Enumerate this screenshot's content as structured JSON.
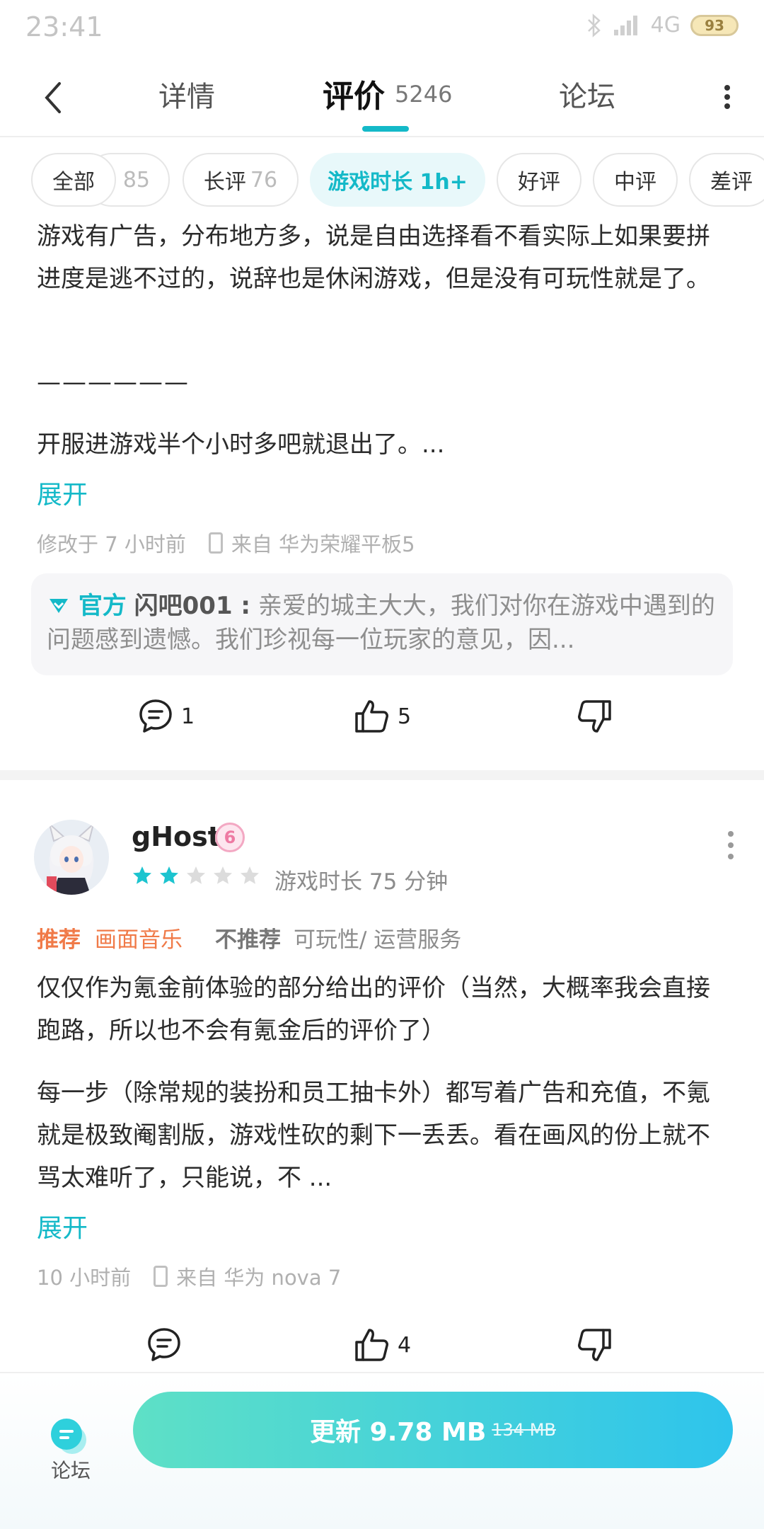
{
  "status_bar": {
    "time": "23:41",
    "network": "4G",
    "battery": "93"
  },
  "header": {
    "tabs": {
      "detail": "详情",
      "review": "评价",
      "review_count": "5246",
      "forum": "论坛"
    }
  },
  "filters": {
    "all": "全部",
    "all_count": "85",
    "long": "长评",
    "long_count": "76",
    "playtime": "游戏时长 1h+",
    "good": "好评",
    "mid": "中评",
    "bad": "差评"
  },
  "review1": {
    "para1": "游戏有广告，分布地方多，说是自由选择看不看实际上如果要拼进度是逃不过的，说辞也是休闲游戏，但是没有可玩性就是了。",
    "separator": "——————",
    "para2": "开服进游戏半个小时多吧就退出了。...",
    "expand": "展开",
    "edited": "修改于 7 小时前",
    "device": "来自 华为荣耀平板5",
    "official_tag": "官方",
    "official_name": "闪吧001 :",
    "official_reply": "亲爱的城主大大，我们对你在游戏中遇到的问题感到遗憾。我们珍视每一位玩家的意见，因...",
    "comments": "1",
    "likes": "5"
  },
  "review2": {
    "username": "gHost",
    "level": "6",
    "rating": 2,
    "rating_max": 5,
    "playtime": "游戏时长 75 分钟",
    "recommend_label": "推荐",
    "recommend_value": "画面音乐",
    "not_recommend_label": "不推荐",
    "not_recommend_value": "可玩性/ 运营服务",
    "para1": "仅仅作为氪金前体验的部分给出的评价（当然，大概率我会直接跑路，所以也不会有氪金后的评价了）",
    "para2": "每一步（除常规的装扮和员工抽卡外）都写着广告和充值，不氪就是极致阉割版，游戏性砍的剩下一丢丢。看在画风的份上就不骂太难听了，只能说，不 ...",
    "expand": "展开",
    "time": "10 小时前",
    "device": "来自 华为 nova 7",
    "likes": "4"
  },
  "bottom": {
    "forum": "论坛",
    "update": "更新 9.78 MB",
    "old_size": "134 MB"
  },
  "colors": {
    "accent": "#14b9c8",
    "recommend": "#f07a48",
    "star_on": "#1cc4cf",
    "star_off": "#dcdcdc"
  }
}
